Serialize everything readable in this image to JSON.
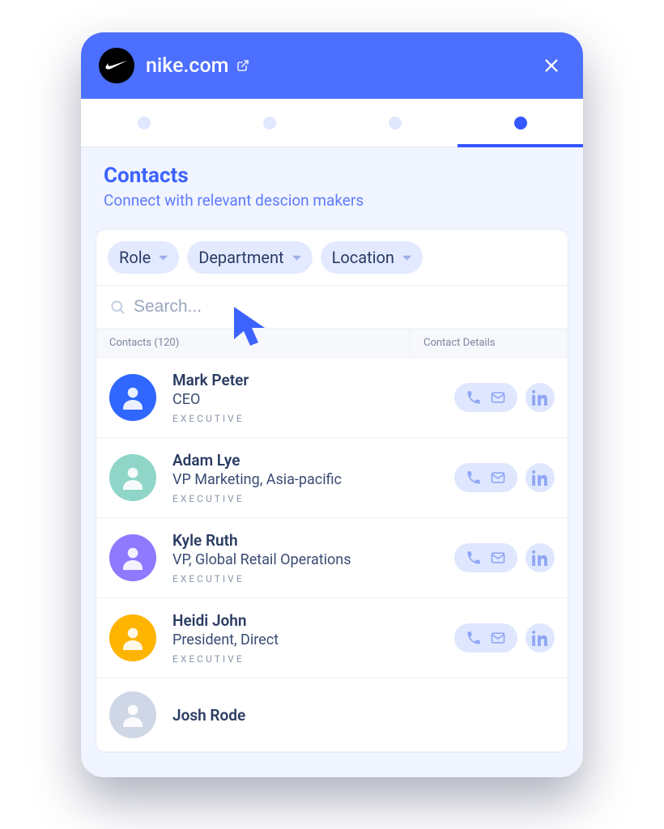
{
  "header": {
    "domain": "nike.com"
  },
  "tabs": {
    "activeIndex": 3,
    "count": 4
  },
  "section": {
    "title": "Contacts",
    "subtitle": "Connect with relevant descion makers"
  },
  "filters": [
    {
      "label": "Role"
    },
    {
      "label": "Department"
    },
    {
      "label": "Location"
    }
  ],
  "search": {
    "placeholder": "Search..."
  },
  "table": {
    "count": 120,
    "head_left": "Contacts (120)",
    "head_right": "Contact Details"
  },
  "contacts": [
    {
      "name": "Mark Peter",
      "title": "CEO",
      "tag": "EXECUTIVE",
      "avatar_bg": "#2f67ff"
    },
    {
      "name": "Adam Lye",
      "title": "VP Marketing, Asia-pacific",
      "tag": "EXECUTIVE",
      "avatar_bg": "#8fd6c8"
    },
    {
      "name": "Kyle Ruth",
      "title": "VP, Global Retail Operations",
      "tag": "EXECUTIVE",
      "avatar_bg": "#8e79ff"
    },
    {
      "name": "Heidi John",
      "title": "President, Direct",
      "tag": "EXECUTIVE",
      "avatar_bg": "#ffb400"
    },
    {
      "name": "Josh Rode",
      "title": "",
      "tag": "",
      "avatar_bg": "#cfd7e6"
    }
  ]
}
